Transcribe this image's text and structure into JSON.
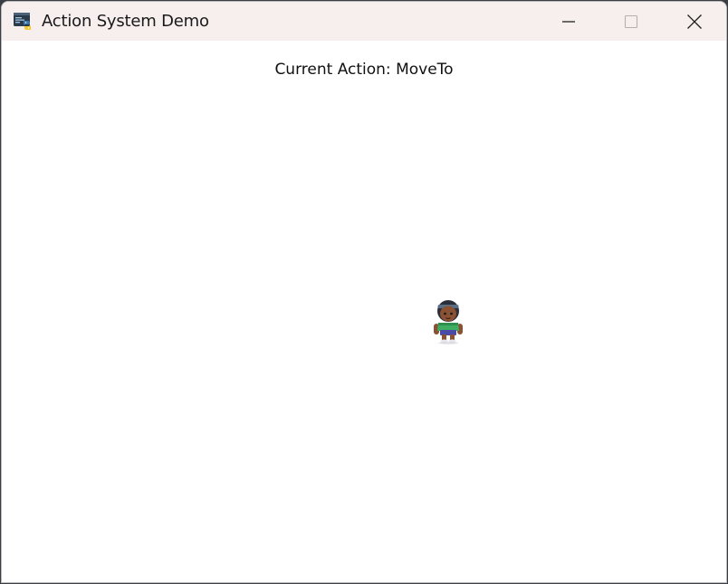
{
  "window": {
    "title": "Action System Demo",
    "icon": "python-app-icon",
    "controls": [
      "minimize",
      "maximize",
      "close"
    ]
  },
  "game": {
    "action_label": "Current Action: MoveTo",
    "sprite": "character-sprite"
  },
  "colors": {
    "titlebar_bg": "#f7eeee",
    "canvas_bg": "#ffffff",
    "text": "#111111"
  }
}
